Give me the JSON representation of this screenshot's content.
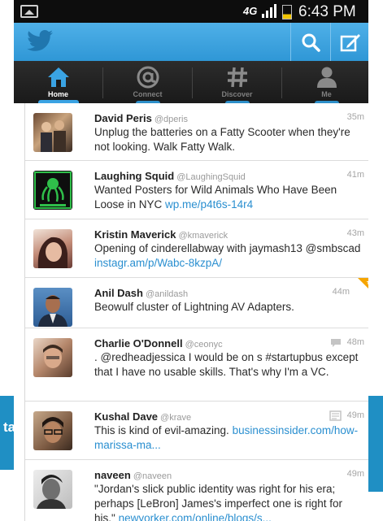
{
  "background": {
    "left_text": "ta"
  },
  "status_bar": {
    "network": "4G",
    "time": "6:43 PM"
  },
  "action_bar": {
    "icons": [
      "twitter-bird-icon",
      "search-icon",
      "compose-icon"
    ]
  },
  "tabs": [
    {
      "label": "Home",
      "icon": "home-icon",
      "active": true
    },
    {
      "label": "Connect",
      "icon": "at-sign-icon",
      "active": false
    },
    {
      "label": "Discover",
      "icon": "hashtag-icon",
      "active": false
    },
    {
      "label": "Me",
      "icon": "person-icon",
      "active": false
    }
  ],
  "tweets": [
    {
      "name": "David Peris",
      "handle": "@dperis",
      "time": "35m",
      "text": "Unplug the batteries on a Fatty Scooter when they're not looking.  Walk Fatty Walk.",
      "link": ""
    },
    {
      "name": "Laughing Squid",
      "handle": "@LaughingSquid",
      "time": "41m",
      "text": "Wanted Posters for Wild Animals Who Have Been Loose in NYC ",
      "link": "wp.me/p4t6s-14r4"
    },
    {
      "name": "Kristin Maverick",
      "handle": "@kmaverick",
      "time": "43m",
      "text": "Opening of cinderellabway with jaymash13 @smbscad ",
      "link": "instagr.am/p/Wabc-8kzpA/"
    },
    {
      "name": "Anil Dash",
      "handle": "@anildash",
      "time": "44m",
      "text": "Beowulf cluster of Lightning AV Adapters.",
      "link": "",
      "favorited": true
    },
    {
      "name": "Charlie O'Donnell",
      "handle": "@ceonyc",
      "time": "48m",
      "text": ". @redheadjessica I would be on s #startupbus except that I have no usable skills.  That's why I'm a VC.",
      "link": "",
      "conversation": true
    },
    {
      "name": "Kushal Dave",
      "handle": "@krave",
      "time": "49m",
      "text": "This is kind of evil-amazing. ",
      "link": "businessinsider.com/how-marissa-ma...",
      "has_media": true
    },
    {
      "name": "naveen",
      "handle": "@naveen",
      "time": "49m",
      "text": "\"Jordan's slick public identity was right for his era; perhaps [LeBron] James's imperfect one is right for his.\" ",
      "link": "newyorker.com/online/blogs/s..."
    }
  ],
  "colors": {
    "action_bar": "#3aa3e3",
    "link": "#2a8fd0",
    "favorite_corner": "#f6a500"
  }
}
